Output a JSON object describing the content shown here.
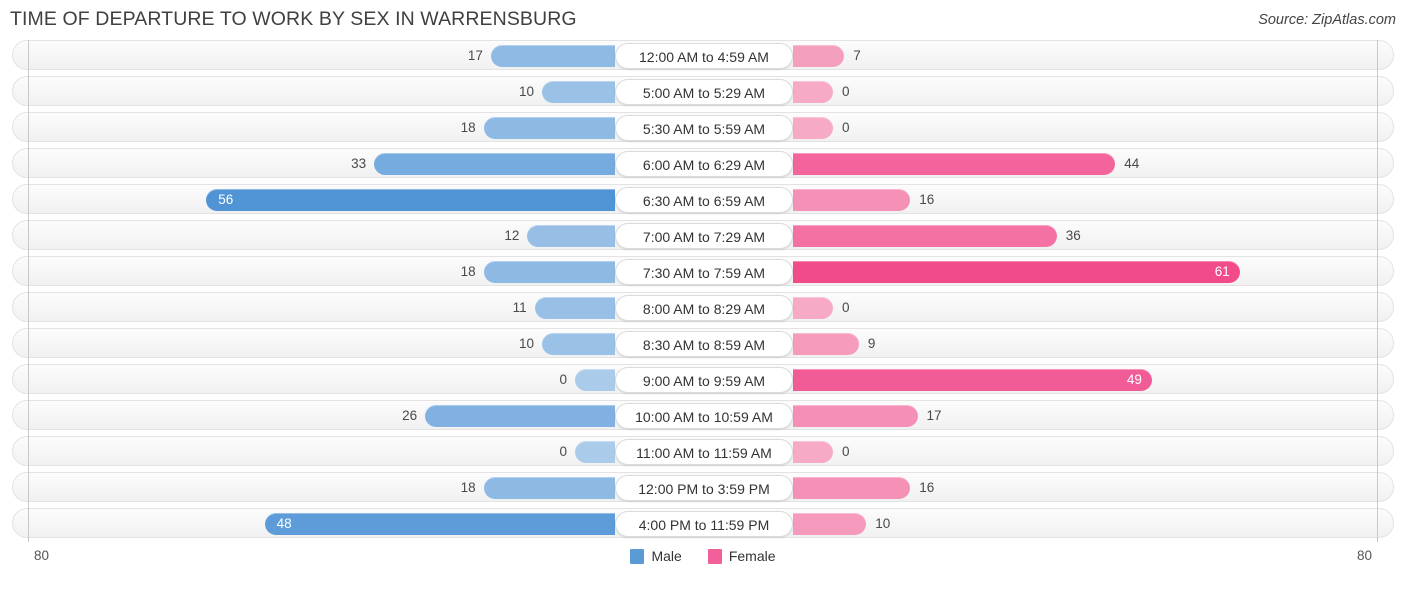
{
  "header": {
    "title": "TIME OF DEPARTURE TO WORK BY SEX IN WARRENSBURG",
    "source": "Source: ZipAtlas.com"
  },
  "legend": {
    "male_label": "Male",
    "female_label": "Female",
    "male_color": "#5b9bd5",
    "female_color": "#f2609b"
  },
  "axis": {
    "left_label": "80",
    "right_label": "80",
    "max": 80
  },
  "chart_data": {
    "type": "bar",
    "orientation": "horizontal-diverging",
    "title": "TIME OF DEPARTURE TO WORK BY SEX IN WARRENSBURG",
    "subtitle": "",
    "xlabel": "",
    "ylabel": "",
    "xlim": [
      80,
      80
    ],
    "grid": false,
    "legend_position": "bottom-center",
    "categories": [
      "12:00 AM to 4:59 AM",
      "5:00 AM to 5:29 AM",
      "5:30 AM to 5:59 AM",
      "6:00 AM to 6:29 AM",
      "6:30 AM to 6:59 AM",
      "7:00 AM to 7:29 AM",
      "7:30 AM to 7:59 AM",
      "8:00 AM to 8:29 AM",
      "8:30 AM to 8:59 AM",
      "9:00 AM to 9:59 AM",
      "10:00 AM to 10:59 AM",
      "11:00 AM to 11:59 AM",
      "12:00 PM to 3:59 PM",
      "4:00 PM to 11:59 PM"
    ],
    "series": [
      {
        "name": "Male",
        "color": "#5b9bd5",
        "values": [
          17,
          10,
          18,
          33,
          56,
          12,
          18,
          11,
          10,
          0,
          26,
          0,
          18,
          48
        ]
      },
      {
        "name": "Female",
        "color": "#f2609b",
        "values": [
          7,
          0,
          0,
          44,
          16,
          36,
          61,
          0,
          9,
          49,
          17,
          0,
          16,
          10
        ]
      }
    ]
  },
  "rows": [
    {
      "category": "12:00 AM to 4:59 AM",
      "male": "17",
      "female": "7"
    },
    {
      "category": "5:00 AM to 5:29 AM",
      "male": "10",
      "female": "0"
    },
    {
      "category": "5:30 AM to 5:59 AM",
      "male": "18",
      "female": "0"
    },
    {
      "category": "6:00 AM to 6:29 AM",
      "male": "33",
      "female": "44"
    },
    {
      "category": "6:30 AM to 6:59 AM",
      "male": "56",
      "female": "16"
    },
    {
      "category": "7:00 AM to 7:29 AM",
      "male": "12",
      "female": "36"
    },
    {
      "category": "7:30 AM to 7:59 AM",
      "male": "18",
      "female": "61"
    },
    {
      "category": "8:00 AM to 8:29 AM",
      "male": "11",
      "female": "0"
    },
    {
      "category": "8:30 AM to 8:59 AM",
      "male": "10",
      "female": "9"
    },
    {
      "category": "9:00 AM to 9:59 AM",
      "male": "0",
      "female": "49"
    },
    {
      "category": "10:00 AM to 10:59 AM",
      "male": "26",
      "female": "17"
    },
    {
      "category": "11:00 AM to 11:59 AM",
      "male": "0",
      "female": "0"
    },
    {
      "category": "12:00 PM to 3:59 PM",
      "male": "18",
      "female": "16"
    },
    {
      "category": "4:00 PM to 11:59 PM",
      "male": "48",
      "female": "10"
    }
  ]
}
